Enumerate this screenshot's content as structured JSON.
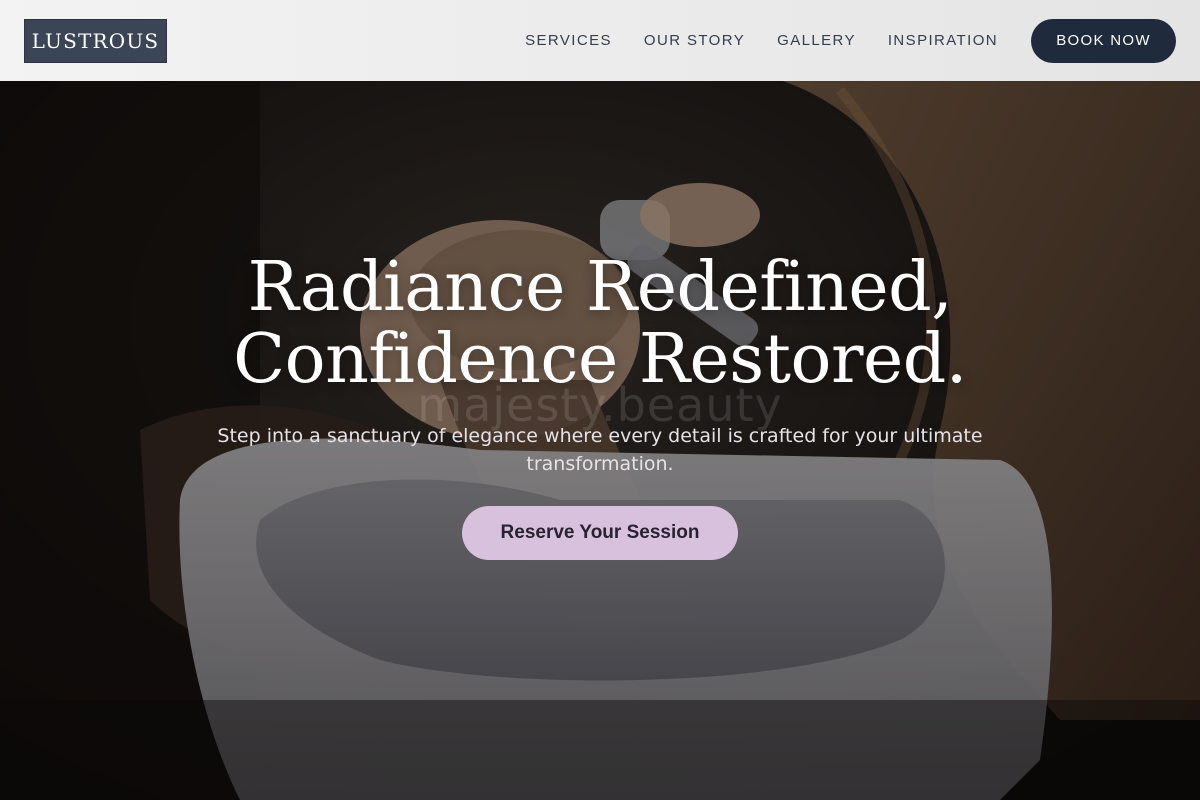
{
  "brand": {
    "logo": "LUSTROUS"
  },
  "nav": {
    "items": [
      {
        "label": "SERVICES"
      },
      {
        "label": "OUR STORY"
      },
      {
        "label": "GALLERY"
      },
      {
        "label": "INSPIRATION"
      }
    ],
    "book_label": "BOOK NOW"
  },
  "hero": {
    "title_line1": "Radiance Redefined,",
    "title_line2": "Confidence Restored.",
    "watermark": "majesty.beauty",
    "subtitle": "Step into a sanctuary of elegance where every detail is crafted for your ultimate transformation.",
    "cta_label": "Reserve Your Session",
    "image_description_icon": "salon-hair-wash-photo"
  },
  "colors": {
    "header_bg": "#ebebeb",
    "logo_bg": "#3c4556",
    "nav_text": "#363d4c",
    "book_button_bg": "#1f2a3d",
    "cta_bg": "#d8c1dc",
    "cta_text": "#2a2233",
    "hero_title": "#ffffff"
  }
}
